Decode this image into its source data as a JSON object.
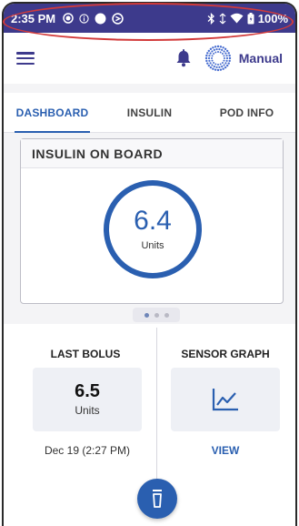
{
  "status_bar": {
    "time": "2:35 PM",
    "battery": "100%",
    "icons": [
      "record-icon",
      "info-icon",
      "circle-icon",
      "sync-icon",
      "bluetooth-icon",
      "signal-icon",
      "wifi-icon",
      "battery-icon"
    ]
  },
  "app_bar": {
    "menu_icon": "hamburger-icon",
    "notification_icon": "bell-icon",
    "mode_icon": "sunburst-icon",
    "mode_label": "Manual"
  },
  "tabs": [
    {
      "label": "DASHBOARD",
      "active": true
    },
    {
      "label": "INSULIN",
      "active": false
    },
    {
      "label": "POD INFO",
      "active": false
    }
  ],
  "insulin_on_board": {
    "title": "INSULIN ON BOARD",
    "value": "6.4",
    "unit": "Units"
  },
  "page_indicator": {
    "count": 3,
    "active_index": 0
  },
  "last_bolus": {
    "title": "LAST BOLUS",
    "value": "6.5",
    "unit": "Units",
    "date": "Dec 19 (2:27 PM)"
  },
  "sensor_graph": {
    "title": "SENSOR GRAPH",
    "icon": "line-chart-icon",
    "action": "VIEW"
  },
  "fab": {
    "icon": "pod-icon"
  },
  "colors": {
    "status_bar": "#3d3a8c",
    "accent": "#2a5fb0",
    "highlight": "#d23a3a"
  }
}
